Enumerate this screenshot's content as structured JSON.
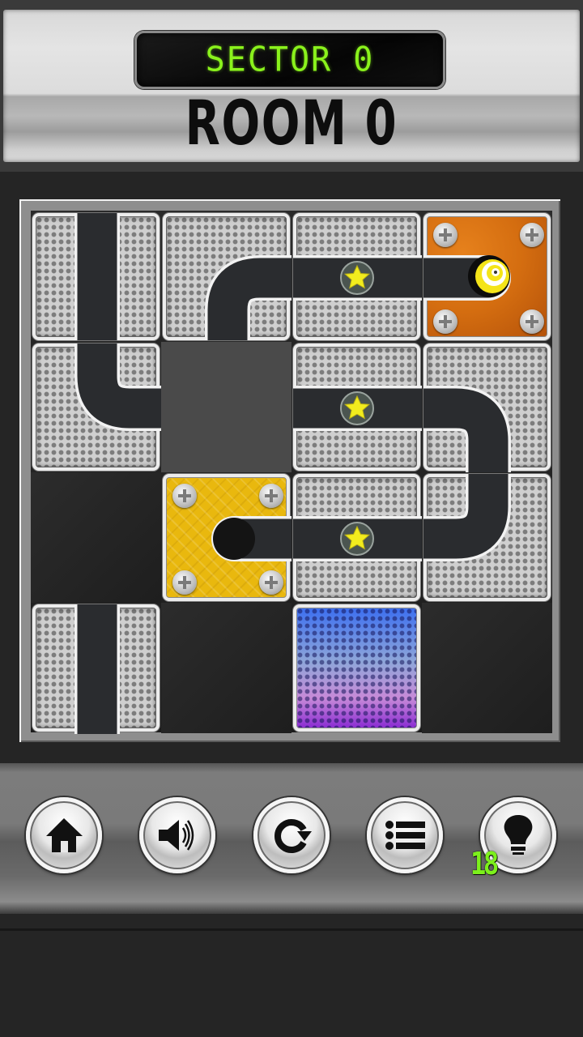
{
  "header": {
    "sector_label": "SECTOR 0",
    "room_label": "ROOM 0"
  },
  "board": {
    "grid_size": [
      4,
      4
    ],
    "cells": [
      {
        "row": 0,
        "col": 0,
        "tile": "mesh",
        "track": "straight-vertical"
      },
      {
        "row": 0,
        "col": 1,
        "tile": "mesh",
        "track": "curve-right-down"
      },
      {
        "row": 0,
        "col": 2,
        "tile": "mesh",
        "track": "straight-horizontal",
        "star": true
      },
      {
        "row": 0,
        "col": 3,
        "tile": "orange-fixed",
        "track": "start-cap-left",
        "ball": true
      },
      {
        "row": 1,
        "col": 0,
        "tile": "mesh",
        "track": "curve-up-right"
      },
      {
        "row": 1,
        "col": 1,
        "tile": "empty",
        "track": "none"
      },
      {
        "row": 1,
        "col": 2,
        "tile": "mesh",
        "track": "straight-horizontal",
        "star": true
      },
      {
        "row": 1,
        "col": 3,
        "tile": "mesh",
        "track": "curve-left-down"
      },
      {
        "row": 2,
        "col": 0,
        "tile": "empty",
        "track": "none"
      },
      {
        "row": 2,
        "col": 1,
        "tile": "yellow-fixed",
        "track": "end-cap-right"
      },
      {
        "row": 2,
        "col": 2,
        "tile": "mesh",
        "track": "straight-horizontal",
        "star": true
      },
      {
        "row": 2,
        "col": 3,
        "tile": "mesh",
        "track": "curve-up-left"
      },
      {
        "row": 3,
        "col": 0,
        "tile": "mesh",
        "track": "straight-vertical"
      },
      {
        "row": 3,
        "col": 1,
        "tile": "empty",
        "track": "none"
      },
      {
        "row": 3,
        "col": 2,
        "tile": "blue-goal",
        "track": "none"
      },
      {
        "row": 3,
        "col": 3,
        "tile": "empty",
        "track": "none"
      }
    ],
    "stars_remaining": 3
  },
  "toolbar": {
    "buttons": [
      {
        "id": "home",
        "icon": "home-icon"
      },
      {
        "id": "sound",
        "icon": "speaker-icon"
      },
      {
        "id": "restart",
        "icon": "restart-icon"
      },
      {
        "id": "menu",
        "icon": "list-icon"
      },
      {
        "id": "hint",
        "icon": "lightbulb-icon"
      }
    ],
    "hint_count": "18"
  },
  "colors": {
    "lcd_green": "#8af21c",
    "track_dark": "#2a2c2f",
    "track_border": "#f2f2f2",
    "star_yellow": "#f2ec1e",
    "orange_tile": "#d46d10",
    "yellow_tile": "#e9b80e"
  }
}
